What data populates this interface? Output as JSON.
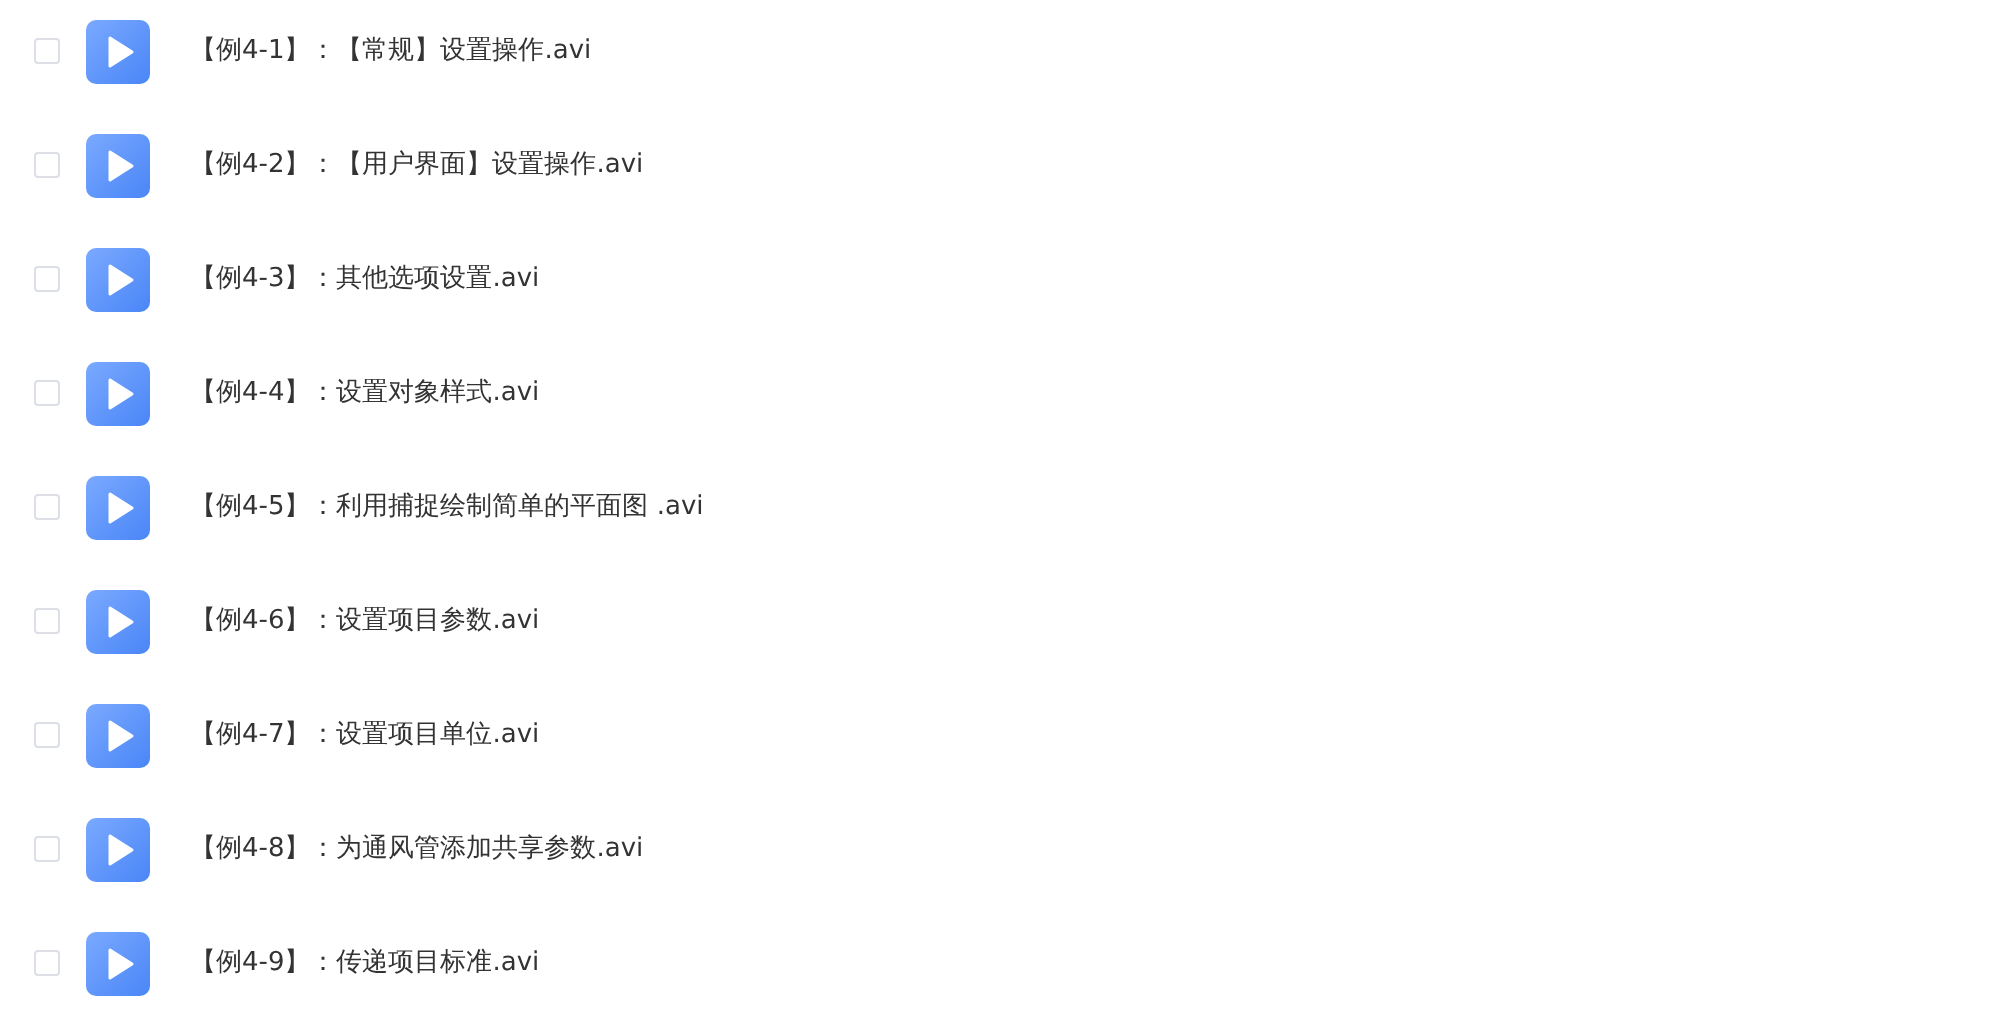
{
  "files": [
    {
      "name": "【例4-1】：【常规】设置操作.avi",
      "checked": false
    },
    {
      "name": "【例4-2】：【用户界面】设置操作.avi",
      "checked": false
    },
    {
      "name": "【例4-3】：其他选项设置.avi",
      "checked": false
    },
    {
      "name": "【例4-4】：设置对象样式.avi",
      "checked": false
    },
    {
      "name": "【例4-5】：利用捕捉绘制简单的平面图 .avi",
      "checked": false
    },
    {
      "name": "【例4-6】：设置项目参数.avi",
      "checked": false
    },
    {
      "name": "【例4-7】：设置项目单位.avi",
      "checked": false
    },
    {
      "name": "【例4-8】：为通风管添加共享参数.avi",
      "checked": false
    },
    {
      "name": "【例4-9】：传递项目标准.avi",
      "checked": false
    }
  ]
}
